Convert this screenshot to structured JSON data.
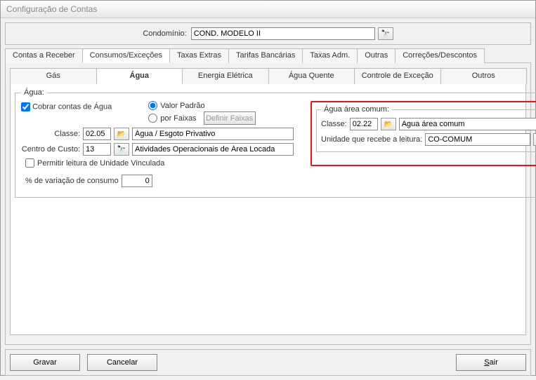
{
  "window": {
    "title": "Configuração de Contas"
  },
  "top": {
    "condominio_label": "Condomínio:",
    "condominio_value": "COND. MODELO II"
  },
  "main_tabs": {
    "contas_receber": "Contas a Receber",
    "consumos_excecoes": "Consumos/Exceções",
    "taxas_extras": "Taxas Extras",
    "tarifas_bancarias": "Tarifas Bancárias",
    "taxas_adm": "Taxas Adm.",
    "outras": "Outras",
    "correcoes_descontos": "Correções/Descontos"
  },
  "sub_tabs": {
    "gas": "Gás",
    "agua": "Água",
    "energia": "Energia Elétrica",
    "agua_quente": "Água Quente",
    "controle": "Controle de Exceção",
    "outros": "Outros"
  },
  "agua": {
    "legend": "Água:",
    "cobrar_label": "Cobrar contas de Água",
    "radio_valor_padrao": "Valor Padrão",
    "radio_por_faixas": "por Faixas",
    "definir_faixas_btn": "Definir Faixas",
    "classe_label": "Classe:",
    "classe_val": "02.05",
    "classe_desc": "Água / Esgoto Privativo",
    "centro_custo_label": "Centro de Custo:",
    "centro_custo_val": "13",
    "centro_custo_desc": "Atividades Operacionais de Área Locada",
    "permitir_label": "Permitir leitura de Unidade Vinculada",
    "percent_label": "% de variação de consumo",
    "percent_val": "0"
  },
  "area_comum": {
    "legend": "Água área comum:",
    "classe_label": "Classe:",
    "classe_val": "02.22",
    "classe_desc": "Agua área comum",
    "unidade_label": "Unidade que recebe a leitura:",
    "unidade_val": "CO-COMUM"
  },
  "footer": {
    "gravar": "Gravar",
    "cancelar": "Cancelar",
    "sair_prefix": "S",
    "sair_rest": "air"
  },
  "icons": {
    "binoculars": "🔭",
    "folder": "📂"
  }
}
